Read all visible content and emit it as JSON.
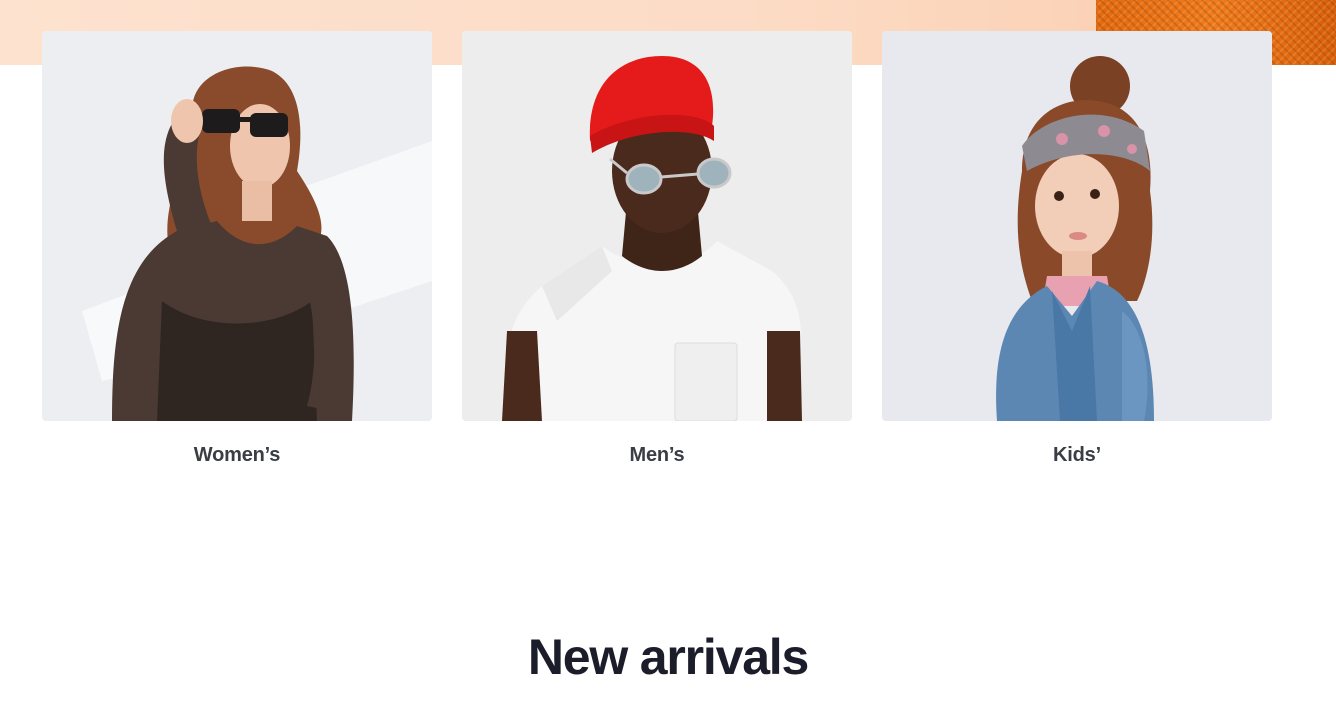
{
  "categories": [
    {
      "label": "Women’s",
      "image": "woman-with-sunglasses"
    },
    {
      "label": "Men’s",
      "image": "man-with-red-beanie"
    },
    {
      "label": "Kids’",
      "image": "girl-with-headband"
    }
  ],
  "new_arrivals": {
    "title": "New arrivals"
  },
  "colors": {
    "hero_peach": "#fde2cf",
    "hero_orange": "#f07b1c",
    "label_text": "#3a3d44",
    "title_text": "#1c1d2a"
  }
}
